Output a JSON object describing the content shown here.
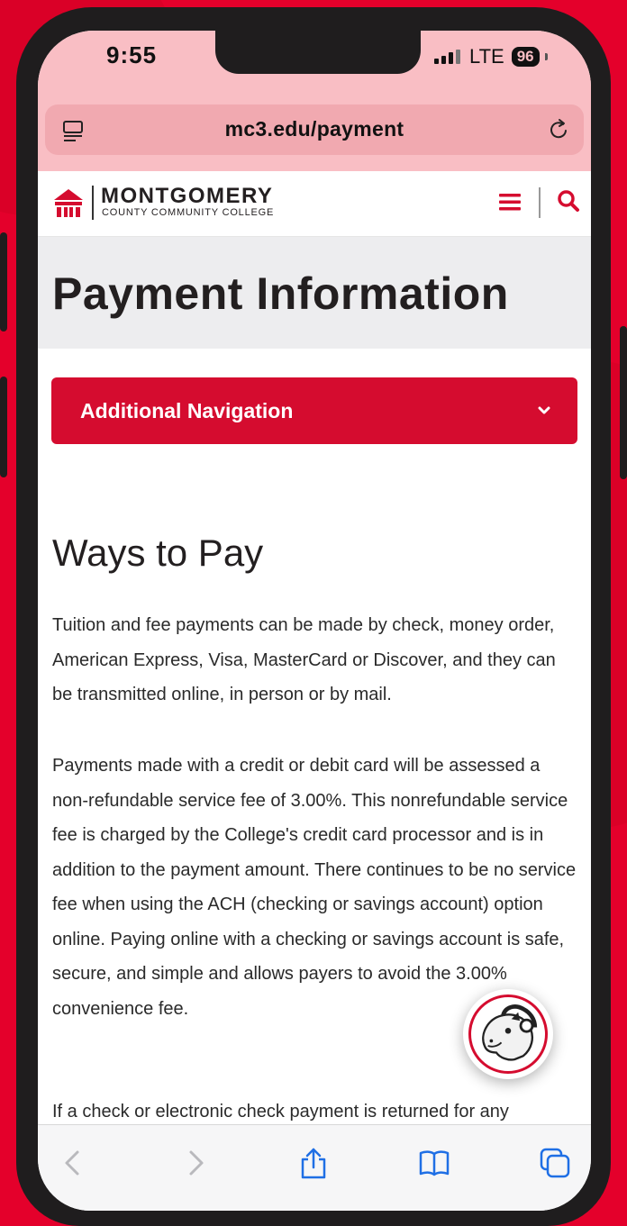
{
  "status": {
    "time": "9:55",
    "network": "LTE",
    "battery": "96"
  },
  "browser": {
    "url": "mc3.edu/payment"
  },
  "site": {
    "logo_name": "MONTGOMERY",
    "logo_sub": "COUNTY COMMUNITY COLLEGE"
  },
  "page": {
    "title": "Payment Information",
    "nav_dropdown_label": "Additional Navigation",
    "section_heading": "Ways to Pay",
    "paragraphs": [
      "Tuition and fee payments can be made by check, money order, American Express, Visa, MasterCard or Discover, and they can be transmitted online, in person or by mail.",
      "Payments made with a credit or debit card will be assessed a non-refundable service fee of 3.00%. This nonrefundable service fee is charged by the College's credit card processor and is in addition to the payment amount. There continues to be no service fee when using the ACH (checking or savings account) option online. Paying online with a checking or savings account is safe, secure, and simple and allows payers to avoid the 3.00% convenience fee.",
      "If a check or electronic check payment is returned for any"
    ]
  },
  "colors": {
    "brand_red": "#d50c2f",
    "background_red": "#e4002b",
    "browser_tint": "#f9bec4"
  },
  "icons": {
    "reader": "reader-mode-icon",
    "reload": "reload-icon",
    "menu": "hamburger-menu-icon",
    "search": "search-icon",
    "back": "chevron-left-icon",
    "forward": "chevron-right-icon",
    "share": "share-icon",
    "bookmarks": "book-icon",
    "tabs": "tabs-icon",
    "mascot": "mustang-mascot-icon"
  }
}
